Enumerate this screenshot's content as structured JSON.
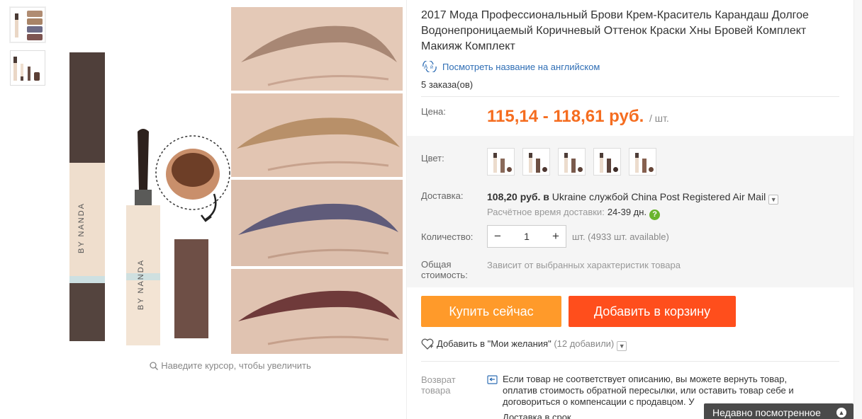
{
  "product": {
    "title": "2017 Мода Профессиональный Брови Крем-Краситель Карандаш Долгое Водонепроницаемый Коричневый Оттенок Краски Хны Бровей Комплект Макияж Комплект",
    "translate_link": "Посмотреть название на английском",
    "orders": "5 заказа(ов)",
    "image_brand_text": "BY NANDA"
  },
  "price": {
    "label": "Цена:",
    "value": "115,14 - 118,61 руб.",
    "unit": "/ шт."
  },
  "color": {
    "label": "Цвет:",
    "swatches": [
      "swatch-1",
      "swatch-2",
      "swatch-3",
      "swatch-4",
      "swatch-5"
    ]
  },
  "shipping": {
    "label": "Доставка:",
    "cost": "108,20 руб.",
    "to_word": "в",
    "country": "Ukraine",
    "by_word": "службой",
    "carrier": "China Post Registered Air Mail",
    "eta_label": "Расчётное время доставки:",
    "eta_value": "24-39 дн.",
    "help": "?"
  },
  "quantity": {
    "label": "Количество:",
    "minus": "−",
    "value": "1",
    "plus": "+",
    "available": "шт. (4933 шт. available)"
  },
  "total": {
    "label": "Общая стоимость:",
    "value": "Зависит от выбранных характеристик товара"
  },
  "actions": {
    "buy_now": "Купить сейчас",
    "add_to_cart": "Добавить в корзину",
    "wishlist": "Добавить в \"Мои желания\"",
    "wishlist_count": "(12 добавили)"
  },
  "returns": {
    "label": "Возврат товара",
    "text": "Если товар не соответствует описанию, вы можете вернуть товар, оплатив стоимость обратной пересылки, или оставить товар себе и договориться о компенсации с продавцом. У",
    "next_row": "Доставка в срок"
  },
  "gallery": {
    "zoom_hint": "Наведите курсор, чтобы увеличить"
  },
  "recently_viewed": "Недавно посмотренное",
  "colors": {
    "price": "#f56d20",
    "buy_now": "#ff9a2a",
    "add_to_cart": "#ff4e1c",
    "link": "#2f6eb5",
    "help_green": "#6ab42d"
  }
}
